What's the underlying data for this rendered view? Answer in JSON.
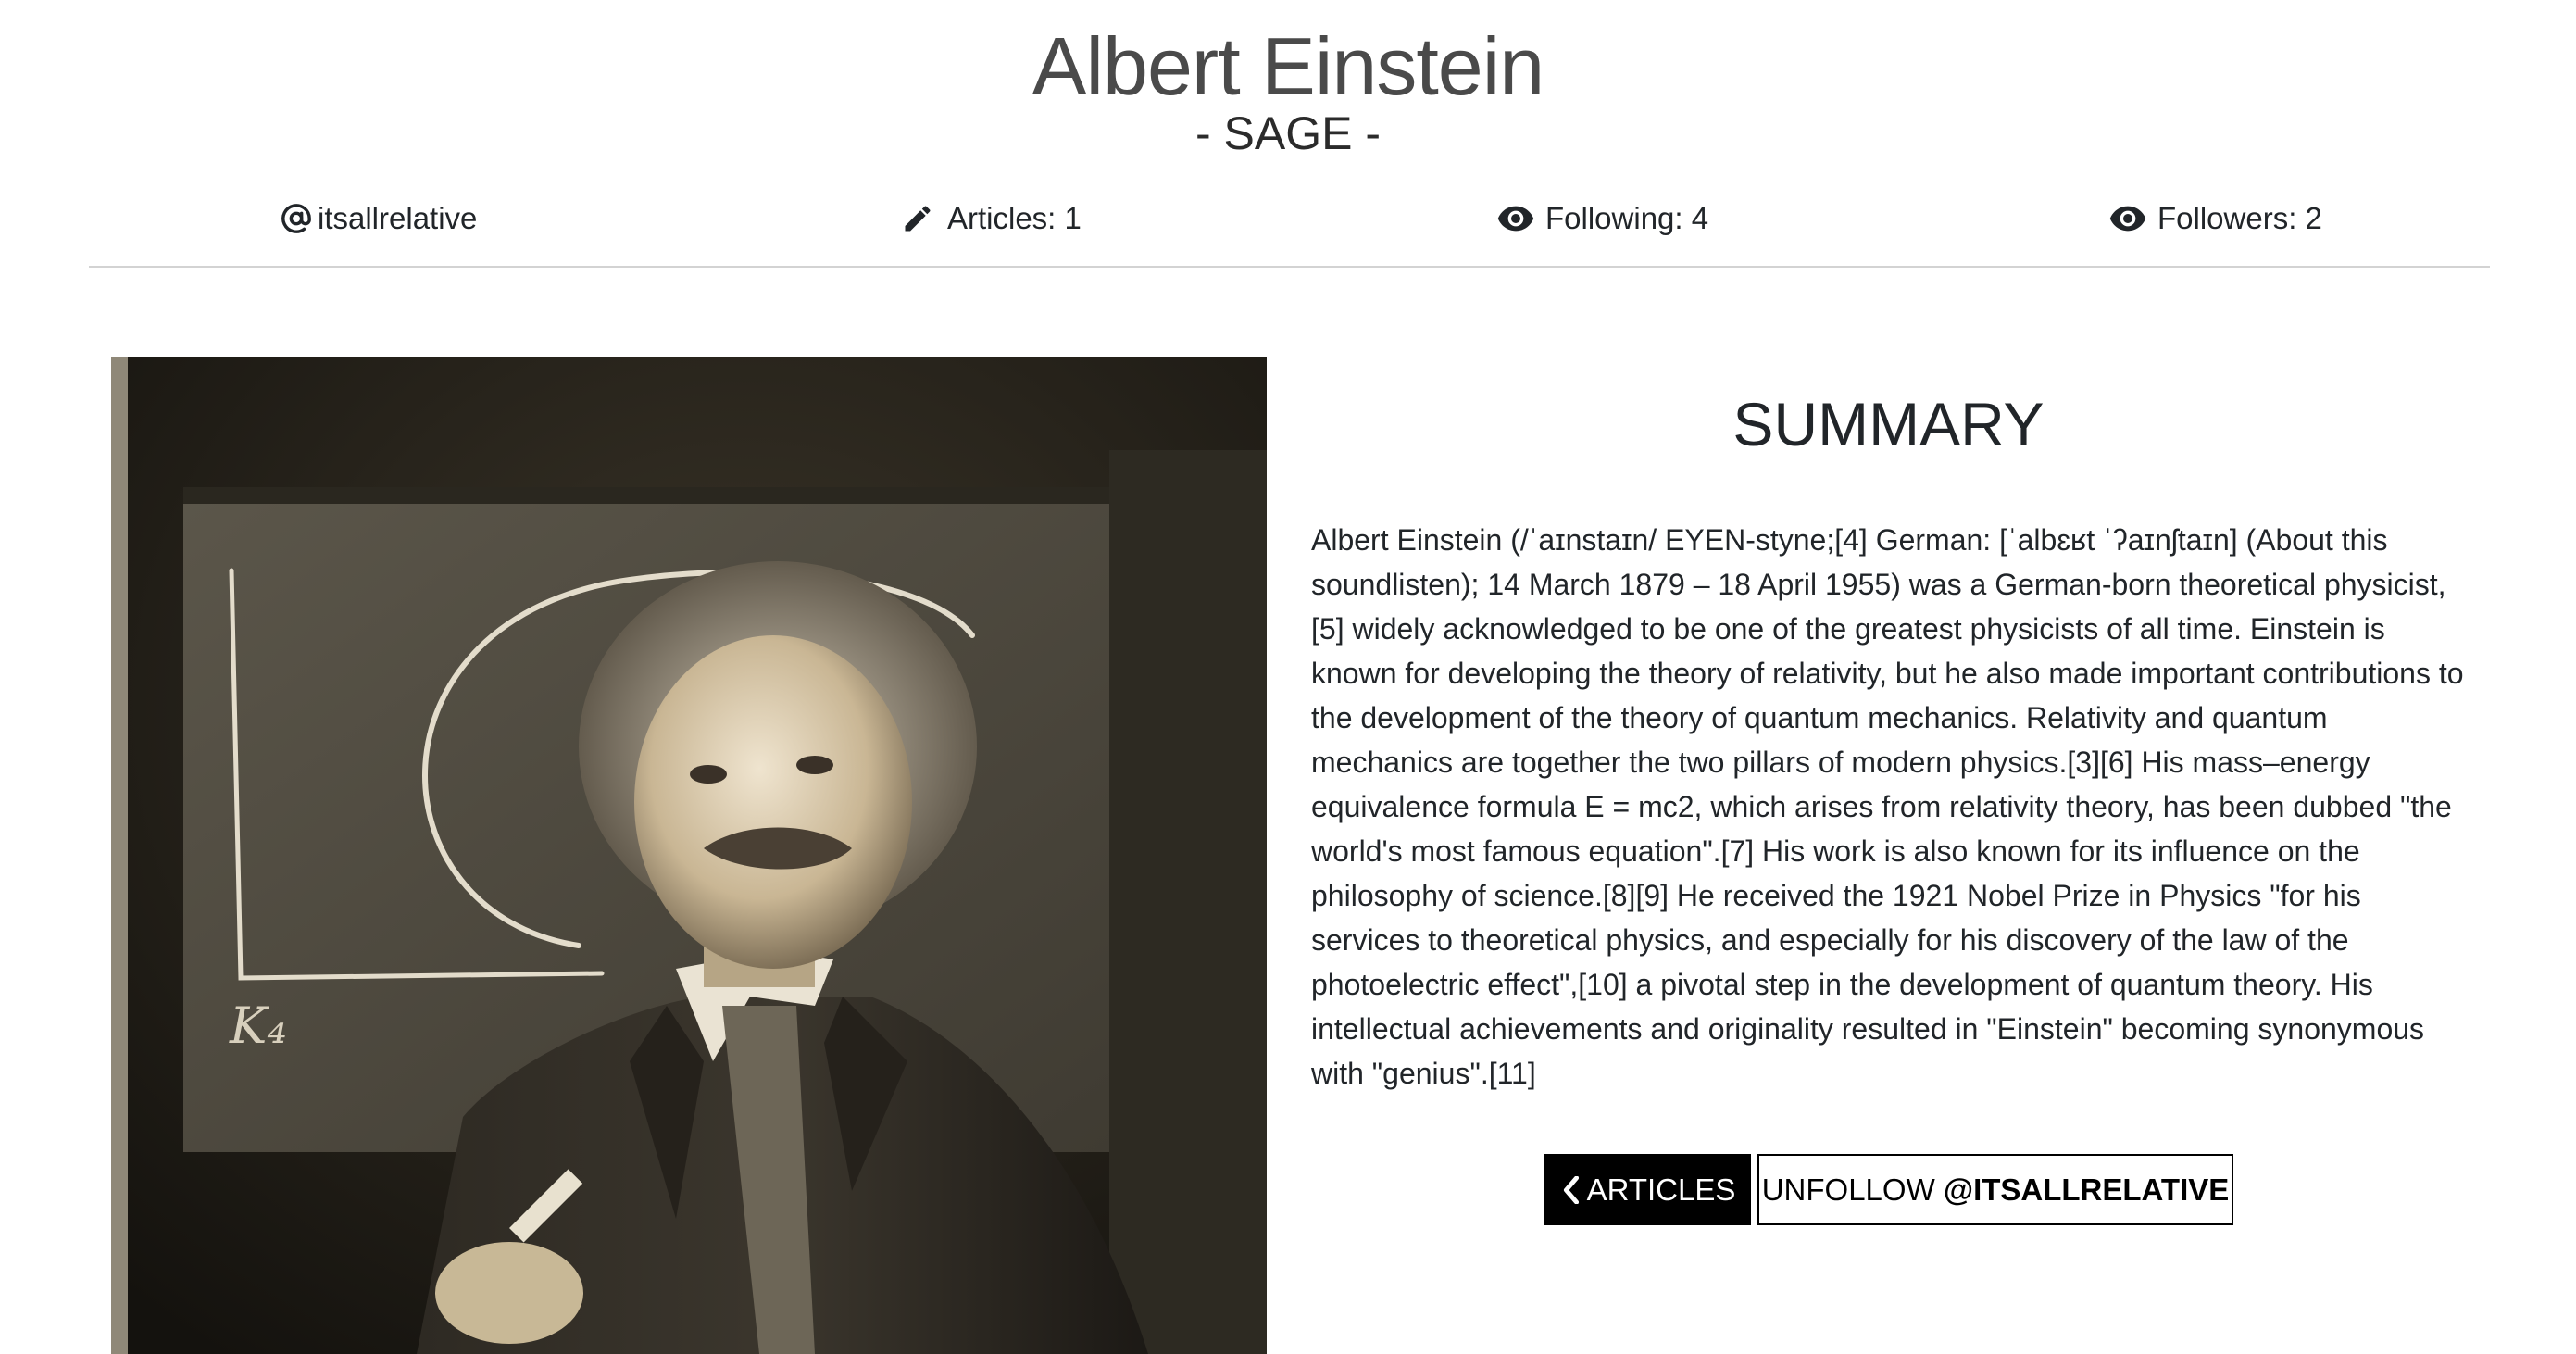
{
  "profile": {
    "name": "Albert Einstein",
    "rank": "- SAGE -"
  },
  "stats": {
    "handle": "itsallrelative",
    "articles": "Articles: 1",
    "following": "Following: 4",
    "followers": "Followers: 2"
  },
  "icons": {
    "handle": "at-sign-icon",
    "articles": "pencil-icon",
    "following": "eye-icon",
    "followers": "eye-icon",
    "back": "chevron-left-icon"
  },
  "summary": {
    "title": "SUMMARY",
    "text": "Albert Einstein (/ˈaɪnstaɪn/ EYEN-styne;[4] German: [ˈalbɛʁt ˈʔaɪnʃtaɪn] (About this soundlisten); 14 March 1879 – 18 April 1955) was a German-born theoretical physicist,[5] widely acknowledged to be one of the greatest physicists of all time. Einstein is known for developing the theory of relativity, but he also made important contributions to the development of the theory of quantum mechanics. Relativity and quantum mechanics are together the two pillars of modern physics.[3][6] His mass–energy equivalence formula E = mc2, which arises from relativity theory, has been dubbed \"the world's most famous equation\".[7] His work is also known for its influence on the philosophy of science.[8][9] He received the 1921 Nobel Prize in Physics \"for his services to theoretical physics, and especially for his discovery of the law of the photoelectric effect\",[10] a pivotal step in the development of quantum theory. His intellectual achievements and originality resulted in \"Einstein\" becoming synonymous with \"genius\".[11]"
  },
  "buttons": {
    "articles_label": "ARTICLES",
    "unfollow_prefix": "UNFOLLOW ",
    "unfollow_handle": "@ITSALLRELATIVE"
  },
  "colors": {
    "primary_button_bg": "#000000",
    "primary_button_text": "#ffffff",
    "divider": "#d3d3d3",
    "title_gray": "#4a4a4a"
  }
}
